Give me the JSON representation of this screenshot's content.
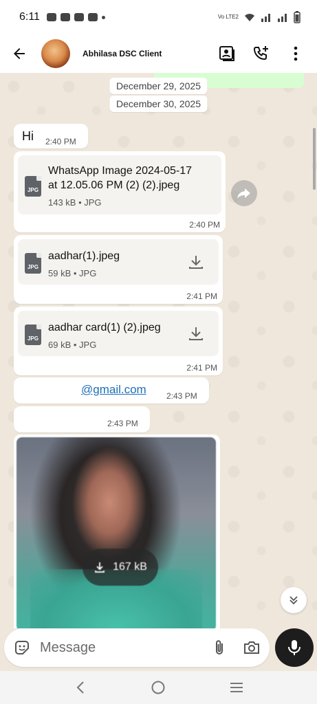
{
  "status_bar": {
    "time": "6:11",
    "network_label": "Vo LTE2"
  },
  "header": {
    "contact_name": "Abhilasa DSC Client"
  },
  "dates": {
    "first": "December 29, 2025",
    "second": "December 30, 2025"
  },
  "messages": [
    {
      "type": "text",
      "text": "Hi",
      "time": "2:40 PM"
    },
    {
      "type": "document",
      "name_line1": "WhatsApp Image 2024-05-17",
      "name_line2": "at 12.05.06 PM (2) (2).jpeg",
      "meta": "143 kB • JPG",
      "icon_label": "JPG",
      "time": "2:40 PM"
    },
    {
      "type": "document",
      "name_line1": "aadhar(1).jpeg",
      "meta": "59 kB • JPG",
      "icon_label": "JPG",
      "time": "2:41 PM"
    },
    {
      "type": "document",
      "name_line1": "aadhar card(1) (2).jpeg",
      "meta": "69 kB • JPG",
      "icon_label": "JPG",
      "time": "2:41 PM"
    },
    {
      "type": "text",
      "text": "@gmail.com",
      "time": "2:43 PM"
    },
    {
      "type": "text",
      "text": "",
      "time": "2:43 PM"
    },
    {
      "type": "image",
      "size_label": "167 kB"
    }
  ],
  "composer": {
    "placeholder": "Message"
  },
  "colors": {
    "chat_bg": "#efe7dc",
    "sent_bubble": "#d9fdd3",
    "link": "#1c6fb8",
    "mic_bg": "#1d1d1d"
  }
}
